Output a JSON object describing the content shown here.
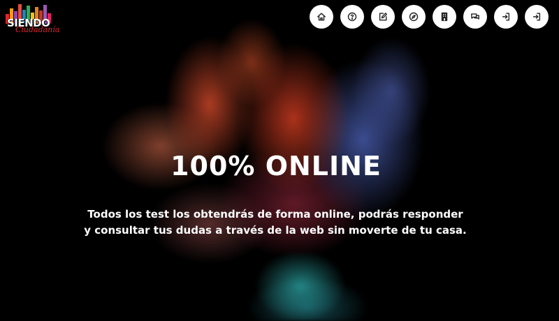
{
  "logo": {
    "word": "SIENDO",
    "script": "Ciudadanía",
    "bar_colors": [
      "#e0262d",
      "#f39c12",
      "#8e44ad",
      "#e74c3c",
      "#2980b9",
      "#27ae60",
      "#f1c40f",
      "#e67e22",
      "#c0392b",
      "#9b59b6",
      "#e91e63"
    ]
  },
  "nav": {
    "items": [
      {
        "icon": "home-icon"
      },
      {
        "icon": "help-icon"
      },
      {
        "icon": "edit-icon"
      },
      {
        "icon": "compass-icon"
      },
      {
        "icon": "building-icon"
      },
      {
        "icon": "chat-icon"
      },
      {
        "icon": "login-icon"
      },
      {
        "icon": "signin-icon"
      }
    ]
  },
  "hero": {
    "title": "100% ONLINE",
    "text": "Todos los test los obtendrás de forma online, podrás responder y consultar tus dudas a través de la web sin moverte de tu casa."
  }
}
